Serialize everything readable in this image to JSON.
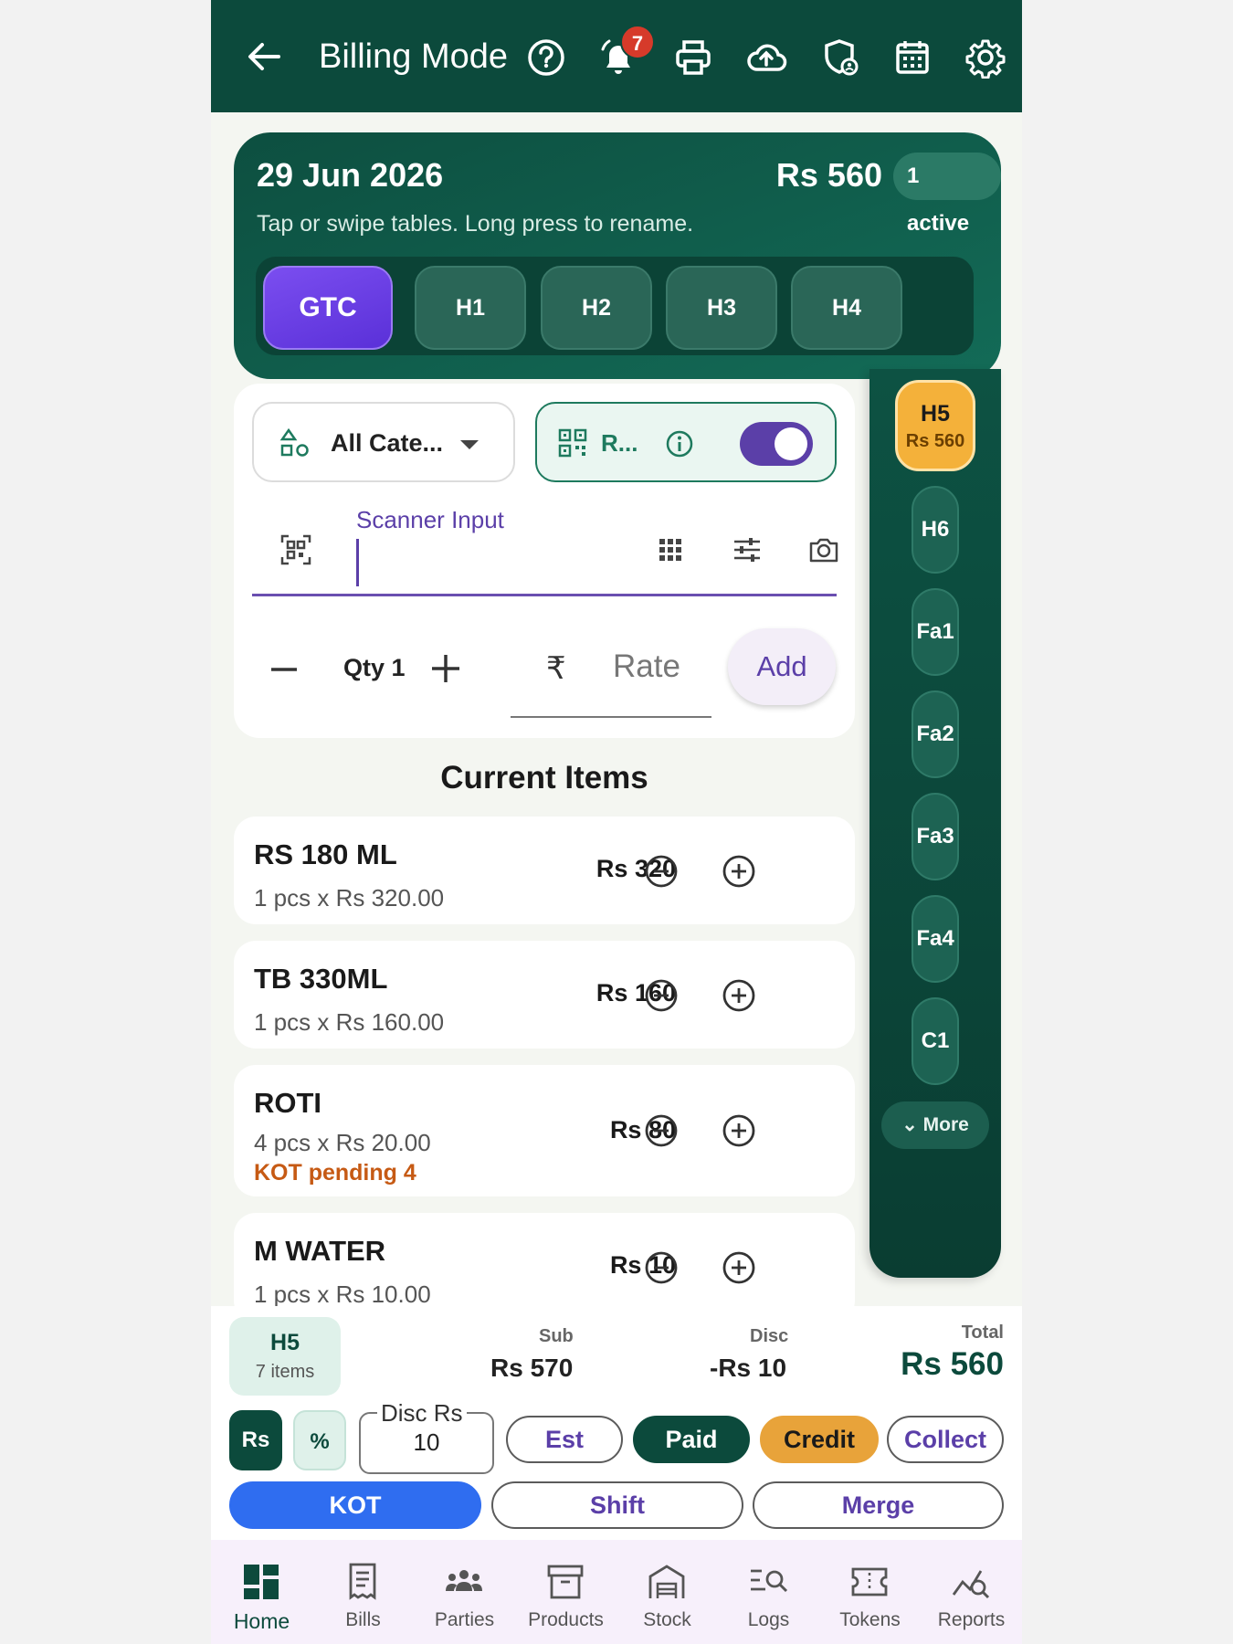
{
  "appbar": {
    "title": "Billing Mode",
    "notification_count": "7",
    "icons": [
      "back-icon",
      "help-icon",
      "bell-icon",
      "printer-icon",
      "cloud-upload-icon",
      "shield-user-icon",
      "calendar-icon",
      "gear-icon"
    ]
  },
  "header": {
    "date": "29 Jun 2026",
    "amount": "Rs 560",
    "active": "1 active",
    "hint": "Tap or swipe tables. Long press to rename.",
    "tables": [
      {
        "label": "GTC",
        "selected": true
      },
      {
        "label": "H1"
      },
      {
        "label": "H2"
      },
      {
        "label": "H3"
      },
      {
        "label": "H4"
      }
    ]
  },
  "rail": {
    "tables": [
      {
        "label": "H5",
        "amount": "Rs 560",
        "selected": true
      },
      {
        "label": "H6"
      },
      {
        "label": "Fa1"
      },
      {
        "label": "Fa2"
      },
      {
        "label": "Fa3"
      },
      {
        "label": "Fa4"
      },
      {
        "label": "C1"
      }
    ],
    "more": "More"
  },
  "inputs": {
    "category": "All Cate...",
    "scan_mode": "R...",
    "scan_toggle_on": true,
    "scanner_label": "Scanner Input",
    "qty": "Qty 1",
    "rate_symbol": "₹",
    "rate_placeholder": "Rate",
    "add": "Add"
  },
  "current_items": {
    "title": "Current Items",
    "items": [
      {
        "name": "RS 180 ML",
        "detail": "1 pcs x Rs 320.00",
        "amount": "Rs 320",
        "kot": ""
      },
      {
        "name": "TB 330ML",
        "detail": "1 pcs x Rs 160.00",
        "amount": "Rs 160",
        "kot": ""
      },
      {
        "name": "ROTI",
        "detail": "4 pcs x Rs 20.00",
        "amount": "Rs 80",
        "kot": "KOT pending 4"
      },
      {
        "name": "M WATER",
        "detail": "1 pcs x Rs 10.00",
        "amount": "Rs 10",
        "kot": ""
      }
    ]
  },
  "summary": {
    "table": "H5",
    "count": "7 items",
    "sub_label": "Sub",
    "sub": "Rs 570",
    "disc_label": "Disc",
    "disc": "-Rs 10",
    "total_label": "Total",
    "total": "Rs 560",
    "mode_rs": "Rs",
    "mode_pct": "%",
    "disc_field_label": "Disc Rs",
    "disc_field_value": "10",
    "est": "Est",
    "paid": "Paid",
    "credit": "Credit",
    "collect": "Collect",
    "kot": "KOT",
    "shift": "Shift",
    "merge": "Merge"
  },
  "nav": [
    {
      "label": "Home",
      "icon": "home-icon",
      "active": true
    },
    {
      "label": "Bills",
      "icon": "receipt-icon"
    },
    {
      "label": "Parties",
      "icon": "people-icon"
    },
    {
      "label": "Products",
      "icon": "archive-box-icon"
    },
    {
      "label": "Stock",
      "icon": "warehouse-icon"
    },
    {
      "label": "Logs",
      "icon": "log-search-icon"
    },
    {
      "label": "Tokens",
      "icon": "ticket-icon"
    },
    {
      "label": "Reports",
      "icon": "chart-search-icon"
    }
  ],
  "colors": {
    "primary": "#0c4a3c",
    "accent_purple": "#5b3fa8",
    "selected_table": "#7b4ef0",
    "rail_selected": "#f4b13a",
    "kot_pending": "#c65a14",
    "kot_button": "#2f6df0",
    "credit": "#e8a33a"
  }
}
